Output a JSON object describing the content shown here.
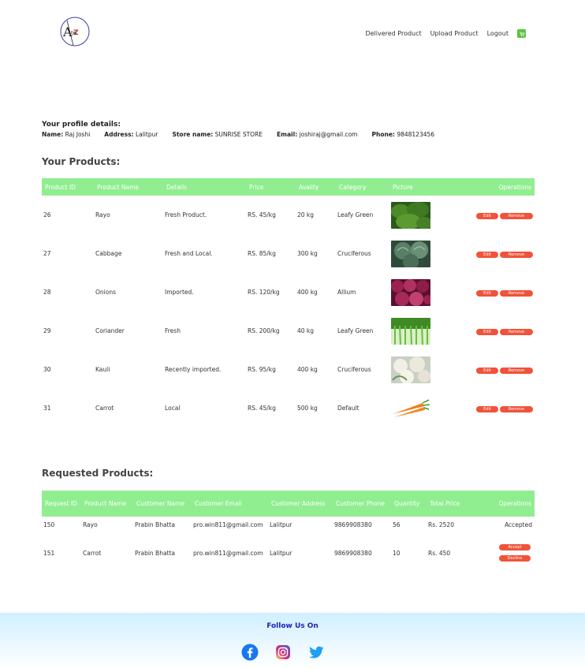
{
  "logo_text": "AtoZ",
  "nav": {
    "delivered": "Delivered Product",
    "upload": "Upload Product",
    "logout": "Logout"
  },
  "profile": {
    "title": "Your profile details:",
    "name_label": "Name:",
    "name": "Raj Joshi",
    "address_label": "Address:",
    "address": "Lalitpur",
    "store_label": "Store name:",
    "store": "SUNRISE STORE",
    "email_label": "Email:",
    "email": "joshiraj@gmail.com",
    "phone_label": "Phone:",
    "phone": "9848123456"
  },
  "products": {
    "title": "Your Products:",
    "headers": [
      "Product ID",
      "Product Name",
      "Details",
      "Price",
      "Avality",
      "Category",
      "Picture",
      "Operations"
    ],
    "edit_label": "Edit",
    "remove_label": "Remove",
    "rows": [
      {
        "id": "26",
        "name": "Rayo",
        "details": "Fresh Product.",
        "price": "RS. 45/kg",
        "qty": "20 kg",
        "category": "Leafy Green",
        "pic": "leafy-greens"
      },
      {
        "id": "27",
        "name": "Cabbage",
        "details": "Fresh and Local.",
        "price": "RS. 85/kg",
        "qty": "300 kg",
        "category": "Cruciferous",
        "pic": "cabbage"
      },
      {
        "id": "28",
        "name": "Onions",
        "details": "Imported.",
        "price": "RS. 120/kg",
        "qty": "400 kg",
        "category": "Allium",
        "pic": "onions"
      },
      {
        "id": "29",
        "name": "Coriander",
        "details": "Fresh",
        "price": "RS. 200/kg",
        "qty": "40 kg",
        "category": "Leafy Green",
        "pic": "coriander"
      },
      {
        "id": "30",
        "name": "Kauli",
        "details": "Recently imported.",
        "price": "RS. 95/kg",
        "qty": "400 kg",
        "category": "Cruciferous",
        "pic": "cauliflower"
      },
      {
        "id": "31",
        "name": "Carrot",
        "details": "Local",
        "price": "RS. 45/kg",
        "qty": "500 kg",
        "category": "Default",
        "pic": "carrot"
      }
    ]
  },
  "requested": {
    "title": "Requested Products:",
    "headers": [
      "Request ID",
      "Product Name",
      "Customer Name",
      "Customer Email",
      "Customer Address",
      "Customer Phone",
      "Quantity",
      "Total Price",
      "Operations"
    ],
    "accept_label": "Accept",
    "decline_label": "Decline",
    "rows": [
      {
        "id": "150",
        "product": "Rayo",
        "customer": "Prabin Bhatta",
        "email": "pro.win811@gmail.com",
        "address": "Lalitpur",
        "phone": "9869908380",
        "qty": "56",
        "total": "Rs. 2520",
        "status": "Accepted"
      },
      {
        "id": "151",
        "product": "Carrot",
        "customer": "Prabin Bhatta",
        "email": "pro.win811@gmail.com",
        "address": "Lalitpur",
        "phone": "9869908380",
        "qty": "10",
        "total": "Rs. 450",
        "status": ""
      }
    ]
  },
  "footer": {
    "follow": "Follow Us On"
  },
  "colors": {
    "header_green": "#90ee90",
    "button_red": "#f0533a",
    "follow_blue": "#1e23b4"
  }
}
